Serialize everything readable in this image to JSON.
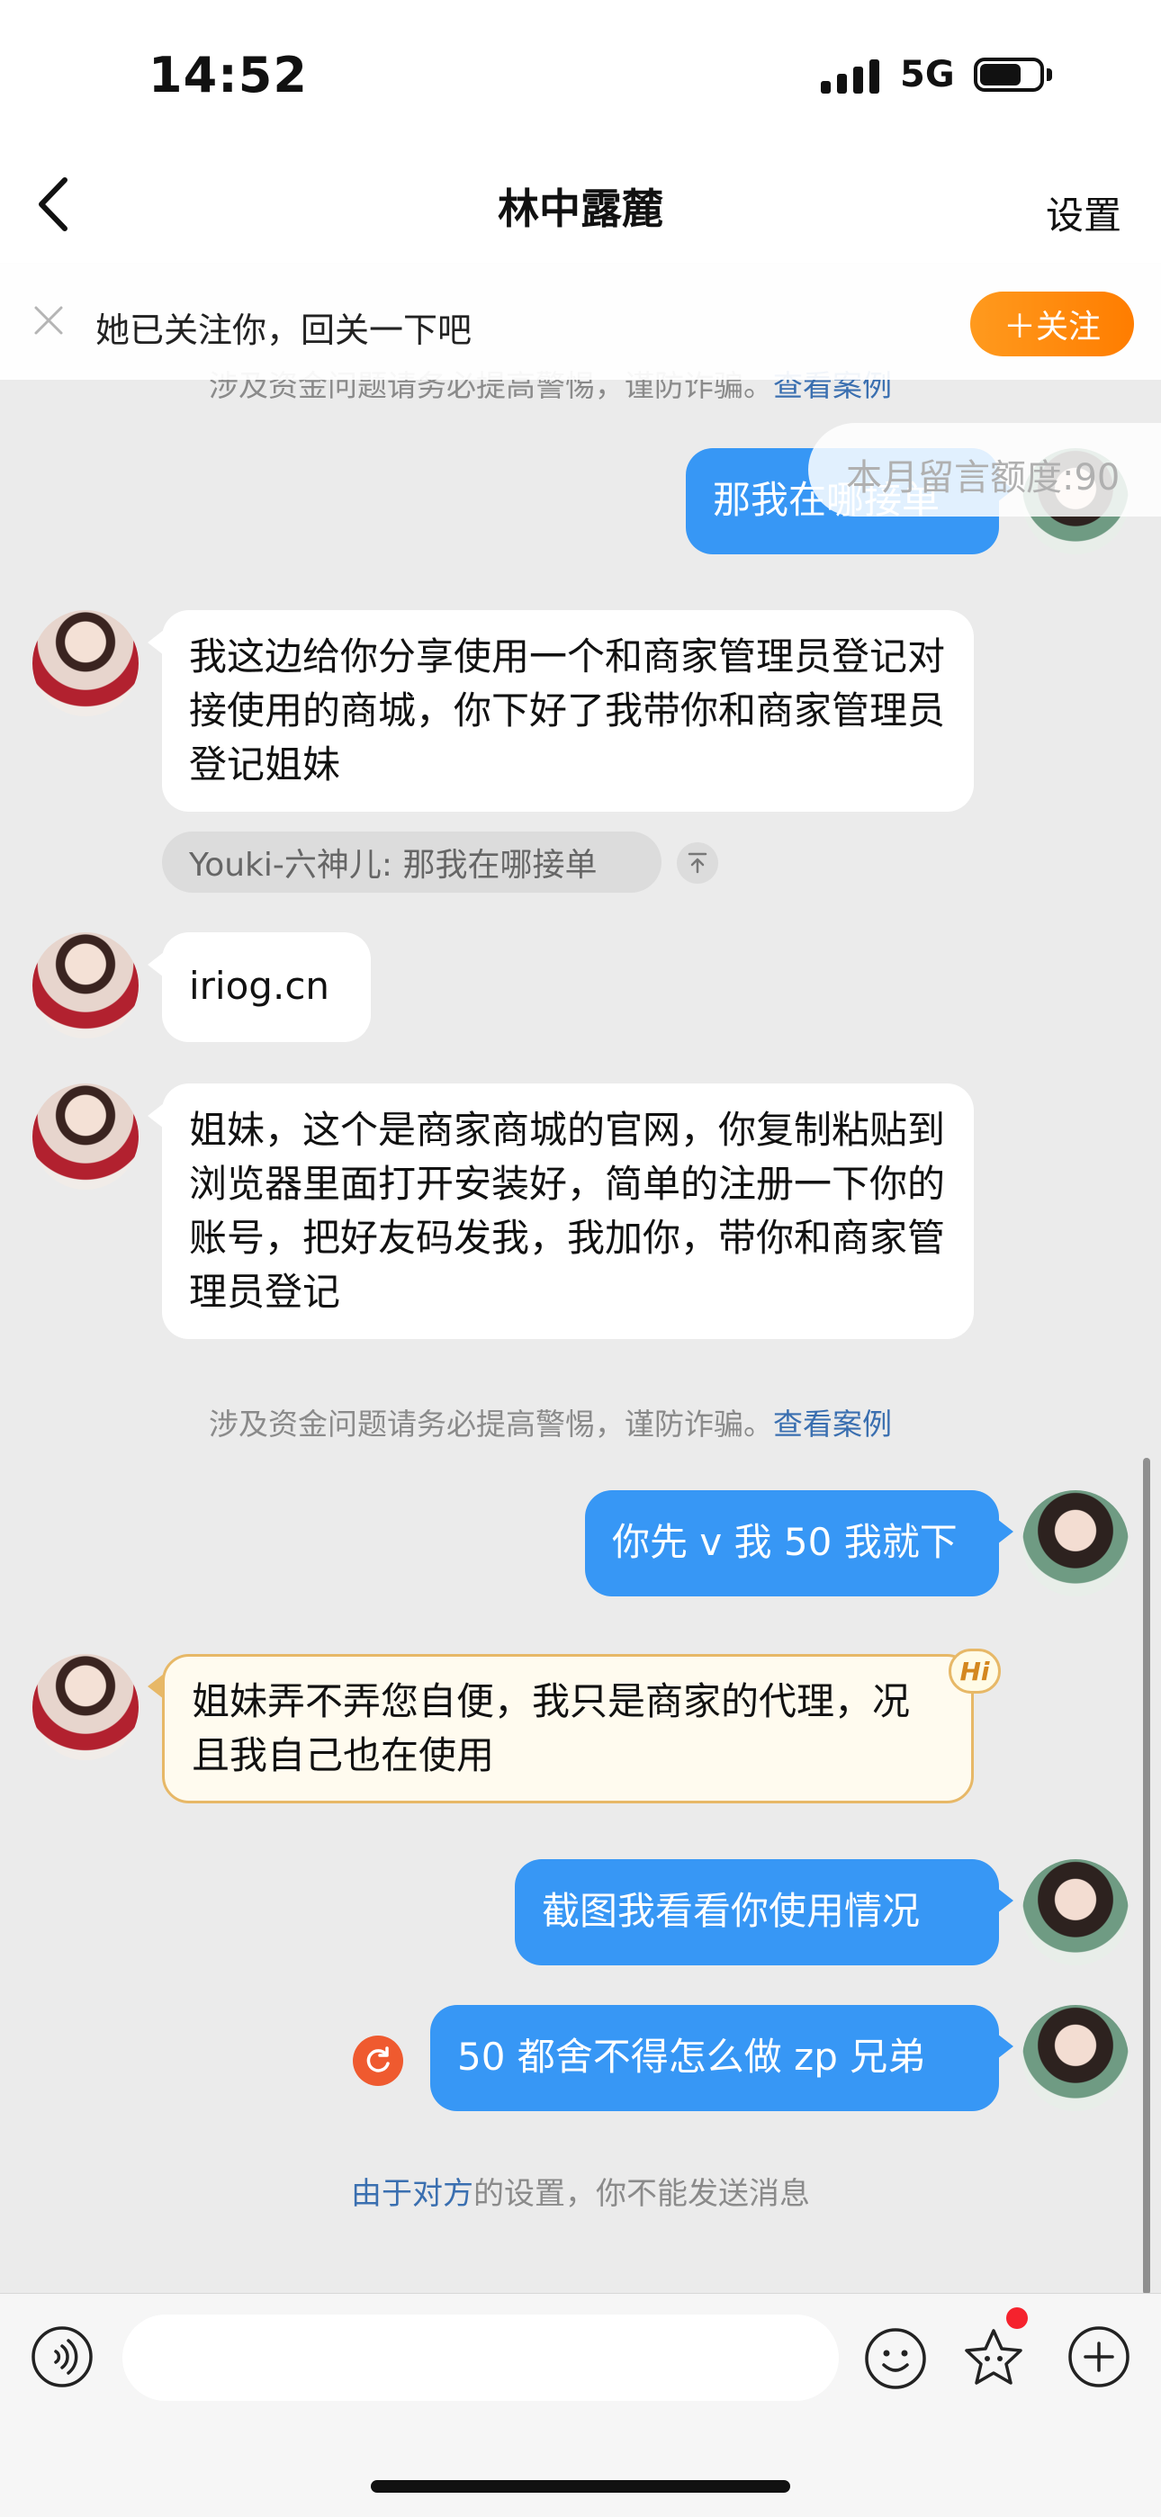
{
  "status_bar": {
    "time": "14:52",
    "network": "5G"
  },
  "nav": {
    "title": "林中露麓",
    "settings": "设置"
  },
  "follow_banner": {
    "text": "她已关注你，回关一下吧",
    "follow_button": "＋关注"
  },
  "quota": "本月留言额度:90",
  "messages": [
    {
      "side": "right",
      "text": "那我在哪接单"
    },
    {
      "side": "left",
      "text": "我这边给你分享使用一个和商家管理员登记对接使用的商城，你下好了我带你和商家管理员登记姐妹",
      "quote": "Youki-六神儿: 那我在哪接单"
    },
    {
      "side": "left",
      "text": "iriog.cn"
    },
    {
      "side": "left",
      "text": "姐妹，这个是商家商城的官网，你复制粘贴到浏览器里面打开安装好，简单的注册一下你的账号，把好友码发我，我加你，带你和商家管理员登记"
    },
    {
      "side": "right",
      "text": "你先 v 我 50 我就下"
    },
    {
      "side": "left",
      "text": "姐妹弄不弄您自便，我只是商家的代理，况且我自己也在使用",
      "badge": "Hi"
    },
    {
      "side": "right",
      "text": "截图我看看你使用情况"
    },
    {
      "side": "right",
      "text": "50 都舍不得怎么做 zp 兄弟",
      "failed": true
    }
  ],
  "warning": {
    "text": "涉及资金问题请务必提高警惕，谨防诈骗。",
    "link": "查看案例"
  },
  "notice": {
    "link": "由于对方",
    "text": "的设置，你不能发送消息"
  },
  "input": {
    "placeholder": ""
  },
  "icons": [
    "back-icon",
    "close-icon",
    "voice-icon",
    "emoji-icon",
    "sticker-icon",
    "plus-icon",
    "resend-icon",
    "pin-top-icon"
  ],
  "colors": {
    "accent": "#3797f5",
    "follow": "#ff8a0c",
    "link": "#3a6fb0",
    "error": "#ef5a2f"
  }
}
